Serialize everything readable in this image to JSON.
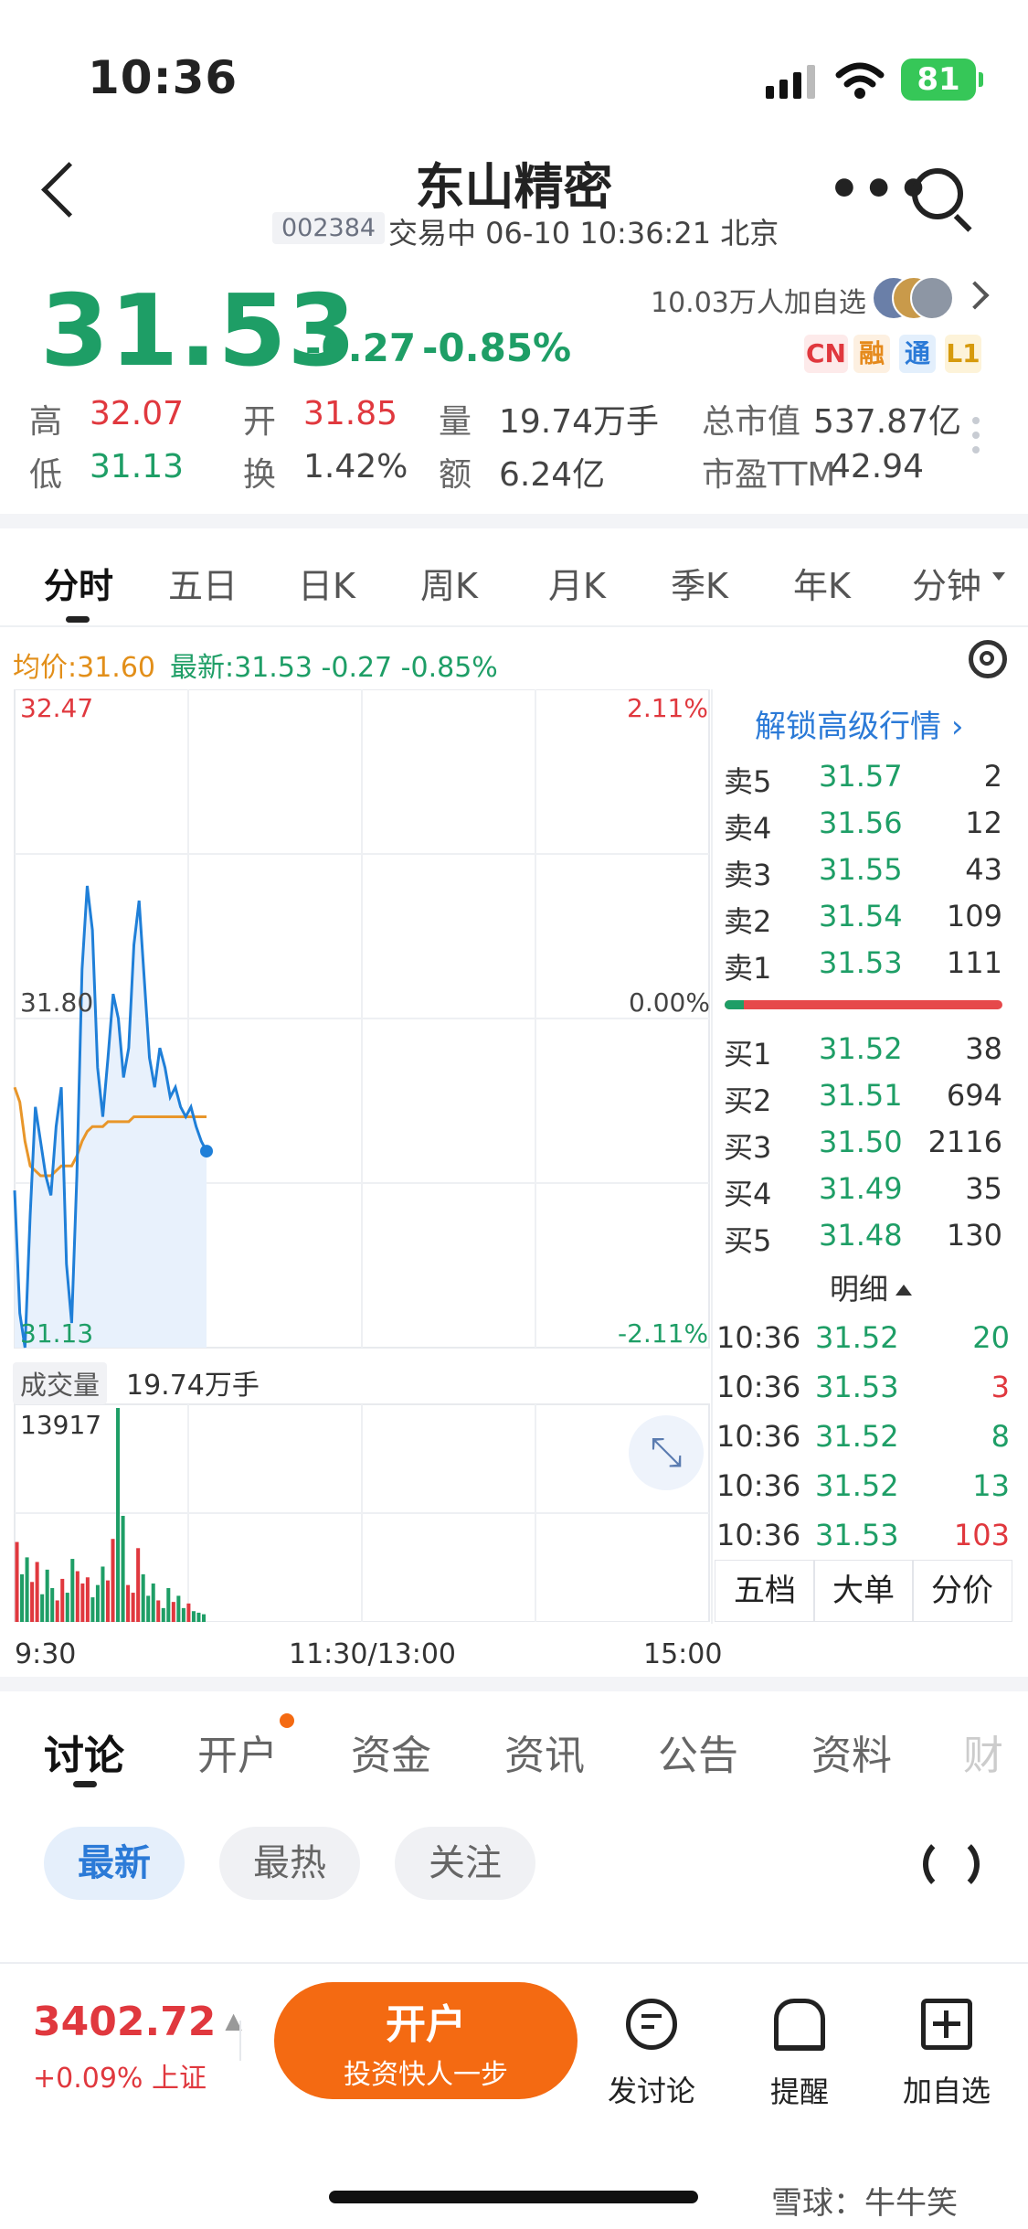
{
  "status_bar": {
    "time": "10:36",
    "battery": "81"
  },
  "header": {
    "title": "东山精密",
    "code": "002384",
    "subtitle": "交易中 06-10 10:36:21 北京"
  },
  "quote": {
    "price": "31.53",
    "change": "-0.27",
    "change_pct": "-0.85%",
    "followers": "10.03万人加自选",
    "tags": [
      "CN",
      "融",
      "通",
      "L1"
    ],
    "stats": [
      {
        "label": "高",
        "value": "32.07",
        "color": "#e0383e"
      },
      {
        "label": "开",
        "value": "31.85",
        "color": "#e0383e"
      },
      {
        "label": "量",
        "value": "19.74万手",
        "color": "#444444"
      },
      {
        "label": "总市值",
        "value": "537.87亿",
        "color": "#444444"
      },
      {
        "label": "低",
        "value": "31.13",
        "color": "#1e9e66"
      },
      {
        "label": "换",
        "value": "1.42%",
        "color": "#444444"
      },
      {
        "label": "额",
        "value": "6.24亿",
        "color": "#444444"
      },
      {
        "label": "市盈TTM",
        "value": "42.94",
        "color": "#444444"
      }
    ]
  },
  "chart_tabs": [
    "分时",
    "五日",
    "日K",
    "周K",
    "月K",
    "季K",
    "年K",
    "分钟"
  ],
  "chart_header": {
    "avg": "均价:31.60",
    "latest": "最新:31.53 -0.27 -0.85%"
  },
  "chart_labels": {
    "high": "32.47",
    "high_pct": "2.11%",
    "mid": "31.80",
    "mid_pct": "0.00%",
    "low": "31.13",
    "low_pct": "-2.11%",
    "vol_max": "13917"
  },
  "order_book": {
    "unlock": "解锁高级行情",
    "asks": [
      {
        "label": "卖5",
        "price": "31.57",
        "qty": "2"
      },
      {
        "label": "卖4",
        "price": "31.56",
        "qty": "12"
      },
      {
        "label": "卖3",
        "price": "31.55",
        "qty": "43"
      },
      {
        "label": "卖2",
        "price": "31.54",
        "qty": "109"
      },
      {
        "label": "卖1",
        "price": "31.53",
        "qty": "111"
      }
    ],
    "buy_ratio": 0.07,
    "bids": [
      {
        "label": "买1",
        "price": "31.52",
        "qty": "38"
      },
      {
        "label": "买2",
        "price": "31.51",
        "qty": "694"
      },
      {
        "label": "买3",
        "price": "31.50",
        "qty": "2116"
      },
      {
        "label": "买4",
        "price": "31.49",
        "qty": "35"
      },
      {
        "label": "买5",
        "price": "31.48",
        "qty": "130"
      }
    ],
    "detail_title": "明细",
    "trades": [
      {
        "time": "10:36",
        "price": "31.52",
        "qty": "20",
        "side": "buy"
      },
      {
        "time": "10:36",
        "price": "31.53",
        "qty": "3",
        "side": "sell"
      },
      {
        "time": "10:36",
        "price": "31.52",
        "qty": "8",
        "side": "buy"
      },
      {
        "time": "10:36",
        "price": "31.52",
        "qty": "13",
        "side": "buy"
      },
      {
        "time": "10:36",
        "price": "31.53",
        "qty": "103",
        "side": "sell"
      }
    ],
    "segments": [
      "五档",
      "大单",
      "分价"
    ]
  },
  "volume": {
    "label": "成交量",
    "value": "19.74万手"
  },
  "time_axis": [
    "9:30",
    "11:30/13:00",
    "15:00"
  ],
  "chart_data": {
    "type": "line",
    "title": "",
    "ylim": [
      31.13,
      32.47
    ],
    "y_ticks": [
      "32.47",
      "31.80",
      "31.13"
    ],
    "series": [
      {
        "name": "最新",
        "values": [
          31.45,
          31.2,
          31.13,
          31.4,
          31.62,
          31.55,
          31.48,
          31.44,
          31.58,
          31.66,
          31.3,
          31.18,
          31.48,
          31.9,
          32.07,
          31.98,
          31.7,
          31.6,
          31.72,
          31.85,
          31.8,
          31.68,
          31.74,
          31.95,
          32.04,
          31.88,
          31.72,
          31.66,
          31.74,
          31.7,
          31.64,
          31.66,
          31.62,
          31.6,
          31.62,
          31.58,
          31.55,
          31.53
        ]
      },
      {
        "name": "均价",
        "values": [
          31.66,
          31.63,
          31.55,
          31.5,
          31.49,
          31.48,
          31.48,
          31.48,
          31.49,
          31.5,
          31.5,
          31.5,
          31.52,
          31.55,
          31.57,
          31.58,
          31.58,
          31.58,
          31.59,
          31.59,
          31.59,
          31.59,
          31.59,
          31.6,
          31.6,
          31.6,
          31.6,
          31.6,
          31.6,
          31.6,
          31.6,
          31.6,
          31.6,
          31.6,
          31.6,
          31.6,
          31.6,
          31.6
        ]
      }
    ],
    "volume_bars": [
      5200,
      3100,
      4200,
      2600,
      3900,
      1800,
      3400,
      2200,
      1400,
      2800,
      1900,
      4100,
      3300,
      2500,
      2900,
      1600,
      2400,
      3600,
      2700,
      5400,
      13917,
      6900,
      2400,
      1900,
      4800,
      3100,
      1700,
      2500,
      1400,
      900,
      2200,
      1300,
      1700,
      900,
      1200,
      700,
      600,
      500
    ],
    "volume_max": 13917
  },
  "bottom_tabs": [
    "讨论",
    "开户",
    "资金",
    "资讯",
    "公告",
    "资料",
    "财"
  ],
  "filters": [
    "最新",
    "最热",
    "关注"
  ],
  "bottom_bar": {
    "index_value": "3402.72",
    "index_change": "+0.09%",
    "index_name": "上证",
    "open_title": "开户",
    "open_sub": "投资快人一步",
    "actions": [
      "发讨论",
      "提醒",
      "加自选"
    ]
  },
  "watermark": "雪球：牛牛笑",
  "colors": {
    "up": "#e0383e",
    "down": "#1e9e66",
    "accent": "#f46a12",
    "link": "#2b7ad7"
  }
}
